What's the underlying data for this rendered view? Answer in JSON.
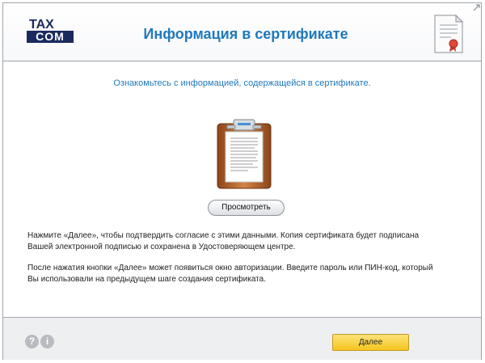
{
  "header": {
    "logo_top": "TAX",
    "logo_bottom": "COM",
    "title": "Информация в сертификате"
  },
  "main": {
    "subtitle": "Ознакомьтесь с информацией, содержащейся в сертификате.",
    "view_button": "Просмотреть",
    "paragraph1_line1": "Нажмите «Далее», чтобы подтвердить согласие с этими данными. Копия сертификата будет подписана",
    "paragraph1_line2": "Вашей электронной подписью и сохранена в Удостоверяющем центре.",
    "paragraph2_line1": "После нажатия кнопки «Далее» может появиться окно авторизации. Введите пароль или ПИН-код, который",
    "paragraph2_line2": "Вы использовали на предыдущем шаге создания сертификата."
  },
  "footer": {
    "help_glyph": "?",
    "info_glyph": "i",
    "next_button": "Далее"
  },
  "icons": {
    "header_right": "certificate-icon",
    "center": "clipboard-document-icon",
    "corner": "resize-icon"
  },
  "colors": {
    "title_blue": "#1f79bd",
    "logo_navy": "#1b2a5e",
    "next_button_yellow": "#f4c51e",
    "clipboard_brown": "#b5642a"
  }
}
